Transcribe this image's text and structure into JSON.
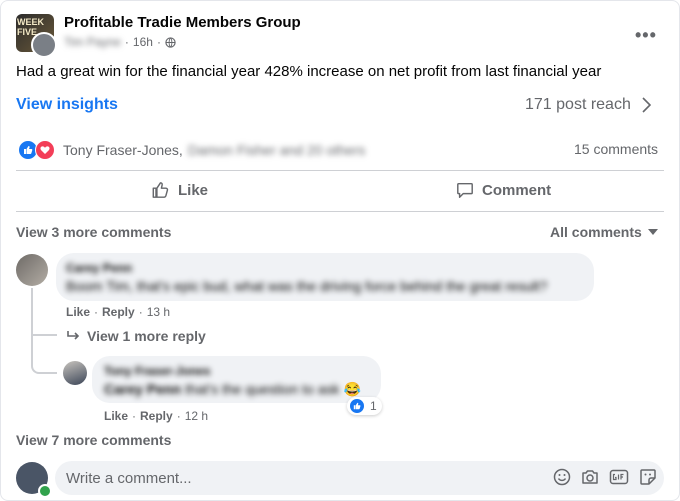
{
  "post": {
    "group_name": "Profitable Tradie Members Group",
    "group_avatar_text": "WEEK FIVE",
    "author": "Tim Payne",
    "time": "16h",
    "separator": "·",
    "audience_icon": "public-globe-icon",
    "more_icon": "three-dots-icon",
    "text": "Had a great win for the financial year 428% increase on net profit from last financial year",
    "insights_label": "View insights",
    "reach": "171 post reach"
  },
  "reactions": {
    "names_visible": "Tony Fraser-Jones,",
    "names_blurred": "Damon Fisher and 20 others",
    "comment_count": "15 comments",
    "like_icon": "like-reaction-icon",
    "love_icon": "love-reaction-icon"
  },
  "actions": {
    "like": "Like",
    "comment": "Comment"
  },
  "comments_header": {
    "view_more": "View 3 more comments",
    "sort": "All comments"
  },
  "comment1": {
    "author": "Carey Penn",
    "text": "Boom Tim, that's epic bud, what was the driving force behind the great result?",
    "like": "Like",
    "dot": "·",
    "reply": "Reply",
    "time": "13 h",
    "view_replies": "View 1 more reply"
  },
  "reply1": {
    "author": "Tony Fraser-Jones",
    "mention": "Carey Penn",
    "text": "that's the question to ask",
    "emoji": "😂",
    "like": "Like",
    "dot": "·",
    "reply": "Reply",
    "time": "12 h",
    "reaction_count": "1"
  },
  "footer": {
    "view_more": "View 7 more comments",
    "placeholder": "Write a comment...",
    "icons": [
      "emoji-icon",
      "camera-icon",
      "gif-icon",
      "sticker-icon"
    ]
  },
  "colors": {
    "brand_blue": "#1877f2",
    "love_red": "#f33e58",
    "muted_text": "#65676b",
    "bubble_bg": "#f0f2f5",
    "online_green": "#31a24c"
  }
}
